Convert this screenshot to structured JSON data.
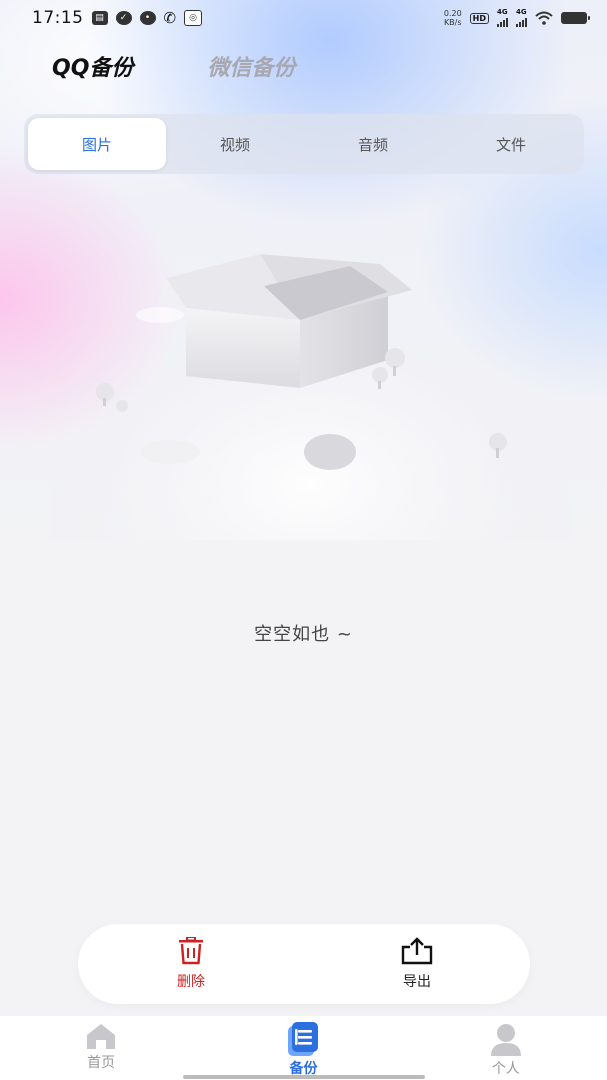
{
  "status_bar": {
    "time": "17:15",
    "net_speed": "0.20",
    "net_unit": "KB/s",
    "hd_label": "HD",
    "sim1_label": "4G",
    "sim2_label": "4G",
    "icons": [
      "gallery-icon",
      "check-icon",
      "message-icon",
      "phone-icon",
      "app-icon",
      "wifi-icon",
      "battery-icon"
    ]
  },
  "title_tabs": [
    {
      "label": "QQ备份",
      "active": true
    },
    {
      "label": "微信备份",
      "active": false
    }
  ],
  "segments": [
    {
      "label": "图片",
      "active": true
    },
    {
      "label": "视频",
      "active": false
    },
    {
      "label": "音频",
      "active": false
    },
    {
      "label": "文件",
      "active": false
    }
  ],
  "empty_state": {
    "text": "空空如也 ~",
    "illustration": "empty-box-illustration"
  },
  "actions": {
    "delete_label": "删除",
    "export_label": "导出"
  },
  "bottom_nav": [
    {
      "label": "首页",
      "icon": "home-icon",
      "active": false
    },
    {
      "label": "备份",
      "icon": "backup-icon",
      "active": true
    },
    {
      "label": "个人",
      "icon": "person-icon",
      "active": false
    }
  ],
  "colors": {
    "accent": "#2b6fe0",
    "delete": "#cc2222",
    "inactive": "#999999"
  }
}
